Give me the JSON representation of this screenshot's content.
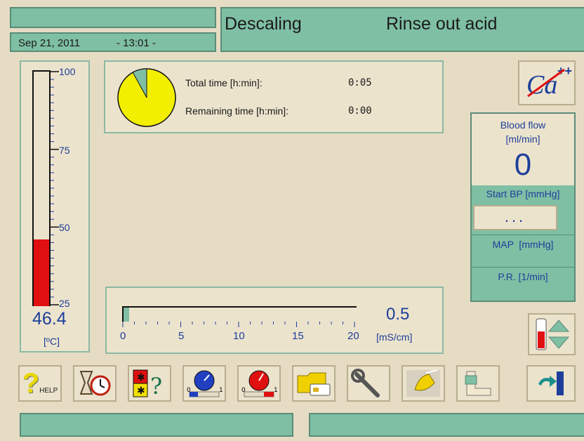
{
  "header": {
    "date": "Sep 21, 2011",
    "time": "- 13:01 -",
    "program": "Descaling",
    "step": "Rinse out acid"
  },
  "timer": {
    "total_label": "Total time [h:min]:",
    "total_value": "0:05",
    "remaining_label": "Remaining time [h:min]:",
    "remaining_value": "0:00",
    "elapsed_fraction": 0.92,
    "pie_color": "#f2f000",
    "pie_remaining_color": "#7fbfa4"
  },
  "temperature": {
    "value": "46.4",
    "unit": "[ºC]",
    "scale_labels": [
      "100",
      "75",
      "50",
      "25"
    ],
    "min": 25,
    "max": 100,
    "current": 46.4,
    "fill_color": "#e01010"
  },
  "conductivity": {
    "value": "0.5",
    "unit": "[mS/cm]",
    "scale_labels": [
      "0",
      "5",
      "10",
      "15",
      "20"
    ],
    "min": 0,
    "max": 20,
    "current": 0.5
  },
  "blood_panel": {
    "flow_label_line1": "Blood flow",
    "flow_label_line2": "[ml/min]",
    "flow_value": "0",
    "start_bp_label": "Start BP [mmHg]",
    "start_bp_button": "...",
    "map_label": "MAP  [mmHg]",
    "pr_label": "P.R. [1/min]"
  },
  "calcium_icon_text": "Ca",
  "calcium_icon_sup": "++",
  "toolbar": {
    "help_label": "HELP",
    "icons": [
      "help-icon",
      "timer-alarm-icon",
      "alarm-info-icon",
      "blue-gauge-icon",
      "red-gauge-icon",
      "folder-card-icon",
      "wrench-icon",
      "cleaning-icon",
      "arm-icon",
      "exit-door-icon"
    ]
  },
  "colors": {
    "background": "#e6dcc4",
    "accent_teal": "#7fbfa4",
    "scale_blue": "#1d3f9a"
  }
}
